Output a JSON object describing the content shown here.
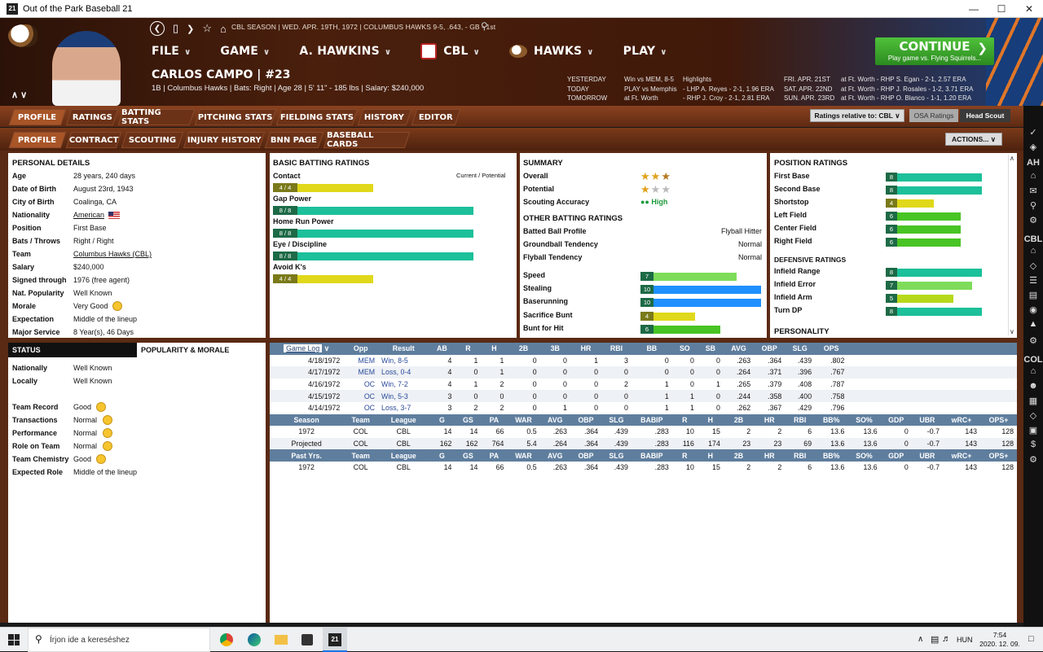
{
  "window": {
    "title": "Out of the Park Baseball 21",
    "app_icon": "21"
  },
  "header": {
    "season_line": "CBL SEASON  |  WED. APR. 19TH, 1972  |  COLUMBUS HAWKS  9-5, .643, - GB - 1st",
    "menu": [
      {
        "label": "FILE"
      },
      {
        "label": "GAME"
      },
      {
        "label": "A. HAWKINS"
      },
      {
        "label": "CBL"
      },
      {
        "label": "HAWKS"
      },
      {
        "label": "PLAY"
      }
    ],
    "player_name": "CARLOS CAMPO  |  #23",
    "player_info": "1B | Columbus Hawks  |  Bats: Right  |  Age 28  |  5' 11\" - 185 lbs  |  Salary: $240,000",
    "schedule": [
      {
        "label": "YESTERDAY",
        "result": "Win vs MEM, 8-5",
        "detail": "Highlights"
      },
      {
        "label": "TODAY",
        "result": "PLAY vs Memphis",
        "detail": "- LHP A. Reyes - 2-1, 1.96 ERA"
      },
      {
        "label": "TOMORROW",
        "result": "at Ft. Worth",
        "detail": "- RHP J. Croy - 2-1, 2.81 ERA"
      }
    ],
    "schedule_future": [
      {
        "date": "FRI. APR. 21ST",
        "detail": "at Ft. Worth - RHP S. Egan - 2-1, 2.57 ERA"
      },
      {
        "date": "SAT. APR. 22ND",
        "detail": "at Ft. Worth - RHP J. Rosales - 1-2, 3.71 ERA"
      },
      {
        "date": "SUN. APR. 23RD",
        "detail": "at Ft. Worth - RHP O. Blanco - 1-1, 1.20 ERA"
      }
    ],
    "continue": {
      "label": "CONTINUE",
      "sub": "Play game vs. Flying Squirrels..."
    }
  },
  "tabs_primary": [
    "PROFILE",
    "RATINGS",
    "BATTING STATS",
    "PITCHING STATS",
    "FIELDING STATS",
    "HISTORY",
    "EDITOR"
  ],
  "tabs_secondary": [
    "PROFILE",
    "CONTRACT",
    "SCOUTING",
    "INJURY HISTORY",
    "BNN PAGE",
    "BASEBALL CARDS"
  ],
  "controls": {
    "ratings_relative": "Ratings relative to: CBL",
    "osa": "OSA Ratings",
    "head_scout": "Head Scout",
    "actions": "ACTIONS..."
  },
  "personal": {
    "title": "PERSONAL DETAILS",
    "rows": [
      {
        "k": "Age",
        "v": "28 years, 240 days"
      },
      {
        "k": "Date of Birth",
        "v": "August 23rd, 1943"
      },
      {
        "k": "City of Birth",
        "v": "Coalinga, CA"
      },
      {
        "k": "Nationality",
        "v": "American"
      },
      {
        "k": "Position",
        "v": "First Base"
      },
      {
        "k": "Bats / Throws",
        "v": "Right / Right"
      },
      {
        "k": "Team",
        "v": "Columbus Hawks (CBL)"
      },
      {
        "k": "Salary",
        "v": "$240,000"
      },
      {
        "k": "Signed through",
        "v": "1976 (free agent)"
      },
      {
        "k": "Nat. Popularity",
        "v": "Well Known"
      },
      {
        "k": "Morale",
        "v": "Very Good"
      },
      {
        "k": "Expectation",
        "v": "Middle of the lineup"
      },
      {
        "k": "Major Service",
        "v": "8 Year(s), 46 Days"
      }
    ]
  },
  "batting": {
    "title": "BASIC BATTING RATINGS",
    "legend": "Current / Potential",
    "rows": [
      {
        "name": "Contact",
        "val": "4 / 4",
        "pct": 0.5,
        "color": "#e0d81a"
      },
      {
        "name": "Gap Power",
        "val": "8 / 8",
        "pct": 1.0,
        "color": "#1cc09a"
      },
      {
        "name": "Home Run Power",
        "val": "8 / 8",
        "pct": 1.0,
        "color": "#1cc09a"
      },
      {
        "name": "Eye / Discipline",
        "val": "8 / 8",
        "pct": 1.0,
        "color": "#1cc09a"
      },
      {
        "name": "Avoid K's",
        "val": "4 / 4",
        "pct": 0.5,
        "color": "#e0d81a"
      }
    ]
  },
  "summary": {
    "title": "SUMMARY",
    "overall": "Overall",
    "potential": "Potential",
    "accuracy_label": "Scouting Accuracy",
    "accuracy": "High",
    "overall_stars": 2.5,
    "potential_stars": 1.0,
    "other_title": "OTHER BATTING RATINGS",
    "other": [
      {
        "k": "Batted Ball Profile",
        "v": "Flyball Hitter"
      },
      {
        "k": "Groundball Tendency",
        "v": "Normal"
      },
      {
        "k": "Flyball Tendency",
        "v": "Normal"
      }
    ],
    "speed": [
      {
        "name": "Speed",
        "val": "7",
        "pct": 0.8,
        "color": "#7edc5a"
      },
      {
        "name": "Stealing",
        "val": "10",
        "pct": 1.0,
        "color": "#1e90ff"
      },
      {
        "name": "Baserunning",
        "val": "10",
        "pct": 1.0,
        "color": "#1e90ff"
      },
      {
        "name": "Sacrifice Bunt",
        "val": "4",
        "pct": 0.45,
        "color": "#e0d81a"
      },
      {
        "name": "Bunt for Hit",
        "val": "6",
        "pct": 0.66,
        "color": "#48c424"
      }
    ]
  },
  "positions": {
    "title": "POSITION RATINGS",
    "rows": [
      {
        "name": "First Base",
        "val": "8",
        "pct": 1.0,
        "color": "#1cc09a"
      },
      {
        "name": "Second Base",
        "val": "8",
        "pct": 1.0,
        "color": "#1cc09a"
      },
      {
        "name": "Shortstop",
        "val": "4",
        "pct": 0.5,
        "color": "#e0d81a"
      },
      {
        "name": "Left Field",
        "val": "6",
        "pct": 0.78,
        "color": "#48c424"
      },
      {
        "name": "Center Field",
        "val": "6",
        "pct": 0.78,
        "color": "#48c424"
      },
      {
        "name": "Right Field",
        "val": "6",
        "pct": 0.78,
        "color": "#48c424"
      }
    ],
    "def_title": "DEFENSIVE RATINGS",
    "def": [
      {
        "name": "Infield Range",
        "val": "8",
        "pct": 1.0,
        "color": "#1cc09a"
      },
      {
        "name": "Infield Error",
        "val": "7",
        "pct": 0.9,
        "color": "#7edc5a"
      },
      {
        "name": "Infield Arm",
        "val": "5",
        "pct": 0.7,
        "color": "#b6d81a"
      },
      {
        "name": "Turn DP",
        "val": "8",
        "pct": 1.0,
        "color": "#1cc09a"
      }
    ],
    "personality": "PERSONALITY"
  },
  "status": {
    "tab1": "STATUS",
    "tab2": "POPULARITY & MORALE",
    "rows1": [
      {
        "k": "Nationally",
        "v": "Well Known"
      },
      {
        "k": "Locally",
        "v": "Well Known"
      }
    ],
    "rows2": [
      {
        "k": "Team Record",
        "v": "Good"
      },
      {
        "k": "Transactions",
        "v": "Normal"
      },
      {
        "k": "Performance",
        "v": "Normal"
      },
      {
        "k": "Role on Team",
        "v": "Normal"
      },
      {
        "k": "Team Chemistry",
        "v": "Good"
      },
      {
        "k": "Expected Role",
        "v": "Middle of the lineup"
      }
    ]
  },
  "gamelog": {
    "select": "Game Log",
    "headers": [
      "Opp",
      "Result",
      "AB",
      "R",
      "H",
      "2B",
      "3B",
      "HR",
      "RBI",
      "BB",
      "SO",
      "SB",
      "AVG",
      "OBP",
      "SLG",
      "OPS"
    ],
    "rows": [
      [
        "4/18/1972",
        "MEM",
        "Win, 8-5",
        "4",
        "1",
        "1",
        "0",
        "0",
        "1",
        "3",
        "0",
        "0",
        "0",
        ".263",
        ".364",
        ".439",
        ".802"
      ],
      [
        "4/17/1972",
        "MEM",
        "Loss, 0-4",
        "4",
        "0",
        "1",
        "0",
        "0",
        "0",
        "0",
        "0",
        "0",
        "0",
        ".264",
        ".371",
        ".396",
        ".767"
      ],
      [
        "4/16/1972",
        "OC",
        "Win, 7-2",
        "4",
        "1",
        "2",
        "0",
        "0",
        "0",
        "2",
        "1",
        "0",
        "1",
        ".265",
        ".379",
        ".408",
        ".787"
      ],
      [
        "4/15/1972",
        "OC",
        "Win, 5-3",
        "3",
        "0",
        "0",
        "0",
        "0",
        "0",
        "0",
        "1",
        "1",
        "0",
        ".244",
        ".358",
        ".400",
        ".758"
      ],
      [
        "4/14/1972",
        "OC",
        "Loss, 3-7",
        "3",
        "2",
        "2",
        "0",
        "1",
        "0",
        "0",
        "1",
        "1",
        "0",
        ".262",
        ".367",
        ".429",
        ".796"
      ]
    ],
    "season_headers": [
      "Season",
      "Team",
      "League",
      "G",
      "GS",
      "PA",
      "WAR",
      "AVG",
      "OBP",
      "SLG",
      "BABIP",
      "R",
      "H",
      "2B",
      "HR",
      "RBI",
      "BB%",
      "SO%",
      "GDP",
      "UBR",
      "wRC+",
      "OPS+"
    ],
    "season_rows": [
      [
        "1972",
        "COL",
        "CBL",
        "14",
        "14",
        "66",
        "0.5",
        ".263",
        ".364",
        ".439",
        ".283",
        "10",
        "15",
        "2",
        "2",
        "6",
        "13.6",
        "13.6",
        "0",
        "-0.7",
        "143",
        "128"
      ],
      [
        "Projected",
        "COL",
        "CBL",
        "162",
        "162",
        "764",
        "5.4",
        ".264",
        ".364",
        ".439",
        ".283",
        "116",
        "174",
        "23",
        "23",
        "69",
        "13.6",
        "13.6",
        "0",
        "-0.7",
        "143",
        "128"
      ]
    ],
    "past_headers": [
      "Past Yrs.",
      "Team",
      "League",
      "G",
      "GS",
      "PA",
      "WAR",
      "AVG",
      "OBP",
      "SLG",
      "BABIP",
      "R",
      "H",
      "2B",
      "HR",
      "RBI",
      "BB%",
      "SO%",
      "GDP",
      "UBR",
      "wRC+",
      "OPS+"
    ],
    "past_rows": [
      [
        "1972",
        "COL",
        "CBL",
        "14",
        "14",
        "66",
        "0.5",
        ".263",
        ".364",
        ".439",
        ".283",
        "10",
        "15",
        "2",
        "2",
        "6",
        "13.6",
        "13.6",
        "0",
        "-0.7",
        "143",
        "128"
      ]
    ]
  },
  "sidebar": {
    "labels": [
      "AH",
      "CBL",
      "COL"
    ]
  },
  "taskbar": {
    "search": "Írjon ide a kereséshez",
    "lang": "HUN",
    "time": "7:54",
    "date": "2020. 12. 09."
  }
}
